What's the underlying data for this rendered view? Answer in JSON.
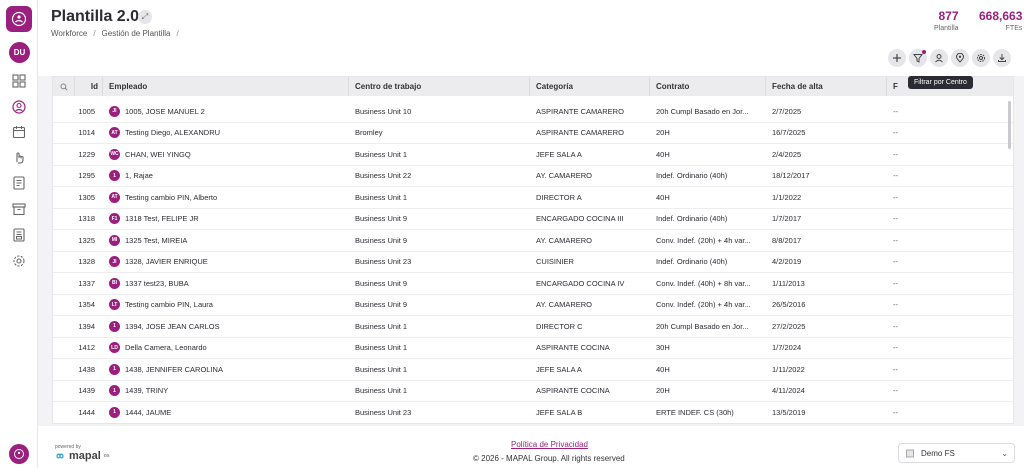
{
  "header": {
    "title": "Plantilla 2.0",
    "breadcrumb": [
      "Workforce",
      "Gestión de Plantilla"
    ],
    "stats": [
      {
        "value": "877",
        "label": "Plantilla"
      },
      {
        "value": "668,663",
        "label": "FTEs"
      }
    ]
  },
  "user": {
    "initials": "DU"
  },
  "toolbar": {
    "tooltip": "Filtrar por Centro"
  },
  "table": {
    "columns": [
      "Id",
      "Empleado",
      "Centro de trabajo",
      "Categoría",
      "Contrato",
      "Fecha de alta",
      "F"
    ],
    "rows": [
      {
        "id": "1005",
        "initials": "JI",
        "name": "1005, JOSE MANUEL 2",
        "centro": "Business Unit 10",
        "cat": "ASPIRANTE CAMARERO",
        "contrato": "20h Cumpl Basado en Jor...",
        "fecha": "2/7/2025",
        "fbaja": "--"
      },
      {
        "id": "1014",
        "initials": "AT",
        "name": "Testing Diego, ALEXANDRU",
        "centro": "Bromley",
        "cat": "ASPIRANTE CAMARERO",
        "contrato": "20H",
        "fecha": "16/7/2025",
        "fbaja": "--"
      },
      {
        "id": "1229",
        "initials": "WC",
        "name": "CHAN, WEI YINGQ",
        "centro": "Business Unit 1",
        "cat": "JEFE SALA A",
        "contrato": "40H",
        "fecha": "2/4/2025",
        "fbaja": "--"
      },
      {
        "id": "1295",
        "initials": "1",
        "name": "1, Rajae",
        "centro": "Business Unit 22",
        "cat": "AY. CAMARERO",
        "contrato": "Indef. Ordinario (40h)",
        "fecha": "18/12/2017",
        "fbaja": "--"
      },
      {
        "id": "1305",
        "initials": "AT",
        "name": "Testing cambio PIN, Alberto",
        "centro": "Business Unit 1",
        "cat": "DIRECTOR A",
        "contrato": "40H",
        "fecha": "1/1/2022",
        "fbaja": "--"
      },
      {
        "id": "1318",
        "initials": "F1",
        "name": "1318 Test, FELIPE JR",
        "centro": "Business Unit 9",
        "cat": "ENCARGADO COCINA III",
        "contrato": "Indef. Ordinario (40h)",
        "fecha": "1/7/2017",
        "fbaja": "--"
      },
      {
        "id": "1325",
        "initials": "MI",
        "name": "1325 Test, MIREIA",
        "centro": "Business Unit 9",
        "cat": "AY. CAMARERO",
        "contrato": "Conv. Indef. (20h) + 4h var...",
        "fecha": "8/8/2017",
        "fbaja": "--"
      },
      {
        "id": "1328",
        "initials": "JI",
        "name": "1328, JAVIER ENRIQUE",
        "centro": "Business Unit 23",
        "cat": "CUISINIER",
        "contrato": "Indef. Ordinario (40h)",
        "fecha": "4/2/2019",
        "fbaja": "--"
      },
      {
        "id": "1337",
        "initials": "BI",
        "name": "1337 test23, BUBA",
        "centro": "Business Unit 9",
        "cat": "ENCARGADO COCINA IV",
        "contrato": "Conv. Indef. (40h) + 8h var...",
        "fecha": "1/11/2013",
        "fbaja": "--"
      },
      {
        "id": "1354",
        "initials": "LT",
        "name": "Testing cambio PIN, Laura",
        "centro": "Business Unit 9",
        "cat": "AY. CAMARERO",
        "contrato": "Conv. Indef. (20h) + 4h var...",
        "fecha": "26/5/2016",
        "fbaja": "--"
      },
      {
        "id": "1394",
        "initials": "1",
        "name": "1394, JOSE JEAN CARLOS",
        "centro": "Business Unit 1",
        "cat": "DIRECTOR C",
        "contrato": "20h Cumpl Basado en Jor...",
        "fecha": "27/2/2025",
        "fbaja": "--"
      },
      {
        "id": "1412",
        "initials": "LD",
        "name": "Della Camera, Leonardo",
        "centro": "Business Unit 1",
        "cat": "ASPIRANTE COCINA",
        "contrato": "30H",
        "fecha": "1/7/2024",
        "fbaja": "--"
      },
      {
        "id": "1438",
        "initials": "1",
        "name": "1438, JENNIFER CAROLINA",
        "centro": "Business Unit 1",
        "cat": "JEFE SALA A",
        "contrato": "40H",
        "fecha": "1/11/2022",
        "fbaja": "--"
      },
      {
        "id": "1439",
        "initials": "1",
        "name": "1439, TRINY",
        "centro": "Business Unit 1",
        "cat": "ASPIRANTE COCINA",
        "contrato": "20H",
        "fecha": "4/11/2024",
        "fbaja": "--"
      },
      {
        "id": "1444",
        "initials": "1",
        "name": "1444, JAUME",
        "centro": "Business Unit 23",
        "cat": "JEFE SALA B",
        "contrato": "ERTE INDEF. CS (30h)",
        "fecha": "13/5/2019",
        "fbaja": "--"
      }
    ]
  },
  "footer": {
    "powered_by": "powered by",
    "brand": "mapal",
    "brand_suffix": "os",
    "privacy": "Política de Privacidad",
    "copyright": "© 2026 - MAPAL Group. All rights reserved",
    "selector": "Demo FS"
  }
}
